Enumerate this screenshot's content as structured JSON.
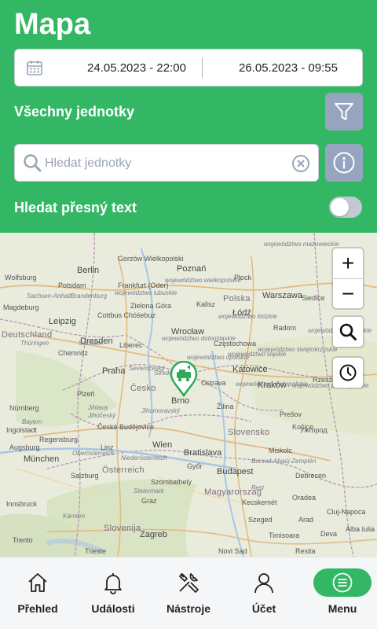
{
  "header": {
    "title": "Mapa",
    "date_from": "24.05.2023 - 22:00",
    "date_to": "26.05.2023 - 09:55",
    "units_label": "Všechny jednotky",
    "search_placeholder": "Hledat jednotky",
    "exact_text_label": "Hledat přesný text",
    "exact_text_enabled": false
  },
  "map": {
    "labels": [
      {
        "t": "Wolfsburg",
        "k": "city"
      },
      {
        "t": "Sachsen-Anhalt",
        "k": "region"
      },
      {
        "t": "Magdeburg",
        "k": "city"
      },
      {
        "t": "Berlin",
        "k": "big"
      },
      {
        "t": "Potsdam",
        "k": "city"
      },
      {
        "t": "Brandenburg",
        "k": "region"
      },
      {
        "t": "Frankfurt (Oder)",
        "k": "city"
      },
      {
        "t": "Gorzów Wielkopolski",
        "k": "city"
      },
      {
        "t": "Zielona Góra",
        "k": "city"
      },
      {
        "t": "Poznań",
        "k": "big"
      },
      {
        "t": "Płock",
        "k": "city"
      },
      {
        "t": "Warszawa",
        "k": "big"
      },
      {
        "t": "Polska",
        "k": "country"
      },
      {
        "t": "Kalisz",
        "k": "city"
      },
      {
        "t": "Łódź",
        "k": "big"
      },
      {
        "t": "Siedlce",
        "k": "city"
      },
      {
        "t": "Radom",
        "k": "city"
      },
      {
        "t": "Leipzig",
        "k": "big"
      },
      {
        "t": "Cottbus Chóśebuz",
        "k": "city"
      },
      {
        "t": "Wrocław",
        "k": "big"
      },
      {
        "t": "Częstochowa",
        "k": "city"
      },
      {
        "t": "Deutschland",
        "k": "country"
      },
      {
        "t": "Dresden",
        "k": "big"
      },
      {
        "t": "Liberec",
        "k": "city"
      },
      {
        "t": "Chemnitz",
        "k": "city"
      },
      {
        "t": "Praha",
        "k": "big"
      },
      {
        "t": "Česko",
        "k": "country"
      },
      {
        "t": "Ostrava",
        "k": "city"
      },
      {
        "t": "Katowice",
        "k": "big"
      },
      {
        "t": "Kraków",
        "k": "big"
      },
      {
        "t": "Rzeszów",
        "k": "city"
      },
      {
        "t": "Plzeň",
        "k": "city"
      },
      {
        "t": "Jihlava",
        "k": "city"
      },
      {
        "t": "Brno",
        "k": "big"
      },
      {
        "t": "Žilina",
        "k": "city"
      },
      {
        "t": "Prešov",
        "k": "city"
      },
      {
        "t": "Košice",
        "k": "city"
      },
      {
        "t": "Nürnberg",
        "k": "city"
      },
      {
        "t": "České Budějovice",
        "k": "city"
      },
      {
        "t": "Slovensko",
        "k": "country"
      },
      {
        "t": "Ужгород",
        "k": "city"
      },
      {
        "t": "Regensburg",
        "k": "city"
      },
      {
        "t": "Ingolstadt",
        "k": "city"
      },
      {
        "t": "Linz",
        "k": "city"
      },
      {
        "t": "Wien",
        "k": "big"
      },
      {
        "t": "Bratislava",
        "k": "big"
      },
      {
        "t": "Miskolc",
        "k": "city"
      },
      {
        "t": "Augsburg",
        "k": "city"
      },
      {
        "t": "München",
        "k": "big"
      },
      {
        "t": "Österreich",
        "k": "country"
      },
      {
        "t": "Győr",
        "k": "city"
      },
      {
        "t": "Budapest",
        "k": "big"
      },
      {
        "t": "Debrecen",
        "k": "city"
      },
      {
        "t": "Salzburg",
        "k": "city"
      },
      {
        "t": "Szombathely",
        "k": "city"
      },
      {
        "t": "Magyarország",
        "k": "country"
      },
      {
        "t": "Kecskemét",
        "k": "city"
      },
      {
        "t": "Oradea",
        "k": "city"
      },
      {
        "t": "Innsbruck",
        "k": "city"
      },
      {
        "t": "Graz",
        "k": "city"
      },
      {
        "t": "Szeged",
        "k": "city"
      },
      {
        "t": "Cluj-Napoca",
        "k": "city"
      },
      {
        "t": "Slovenija",
        "k": "country"
      },
      {
        "t": "Zagreb",
        "k": "big"
      },
      {
        "t": "Timisoara",
        "k": "city"
      },
      {
        "t": "Trento",
        "k": "city"
      },
      {
        "t": "Trieste",
        "k": "city"
      },
      {
        "t": "Resita",
        "k": "city"
      },
      {
        "t": "Deva",
        "k": "city"
      },
      {
        "t": "Novi Sad",
        "k": "city"
      },
      {
        "t": "Arad",
        "k": "city"
      },
      {
        "t": "Alba Iulia",
        "k": "city"
      },
      {
        "t": "Bayern",
        "k": "region"
      },
      {
        "t": "Sachsen",
        "k": "region"
      },
      {
        "t": "Thüringen",
        "k": "region"
      },
      {
        "t": "Oberösterreich",
        "k": "region"
      },
      {
        "t": "Niederösterreich",
        "k": "region"
      },
      {
        "t": "Steiermark",
        "k": "region"
      },
      {
        "t": "Kärnten",
        "k": "region"
      },
      {
        "t": "Jihočeský",
        "k": "region"
      },
      {
        "t": "Jihomoravský",
        "k": "region"
      },
      {
        "t": "Severočeský",
        "k": "region"
      },
      {
        "t": "Středočeský",
        "k": "region"
      },
      {
        "t": "województwo wielkopolskie",
        "k": "region"
      },
      {
        "t": "województwo dolnośląskie",
        "k": "region"
      },
      {
        "t": "województwo śląskie",
        "k": "region"
      },
      {
        "t": "województwo małopolskie",
        "k": "region"
      },
      {
        "t": "województwo świętokrzyskie",
        "k": "region"
      },
      {
        "t": "województwo mazowieckie",
        "k": "region"
      },
      {
        "t": "województwo łódzkie",
        "k": "region"
      },
      {
        "t": "województwo opolskie",
        "k": "region"
      },
      {
        "t": "województwo podkarpackie",
        "k": "region"
      },
      {
        "t": "województwo lubuskie",
        "k": "region"
      },
      {
        "t": "województwo lubelskie",
        "k": "region"
      },
      {
        "t": "Pest",
        "k": "region"
      },
      {
        "t": "Borsod-Abaúj-Zemplén",
        "k": "region"
      }
    ]
  },
  "map_controls": {
    "zoom_in": "+",
    "zoom_out": "−"
  },
  "nav": {
    "items": [
      {
        "label": "Přehled",
        "icon": "home-icon"
      },
      {
        "label": "Události",
        "icon": "bell-icon"
      },
      {
        "label": "Nástroje",
        "icon": "tools-icon"
      },
      {
        "label": "Účet",
        "icon": "user-icon"
      },
      {
        "label": "Menu",
        "icon": "menu-icon",
        "active": true
      }
    ]
  },
  "colors": {
    "brand_green": "#34b765",
    "button_gray": "#97a4c0"
  }
}
